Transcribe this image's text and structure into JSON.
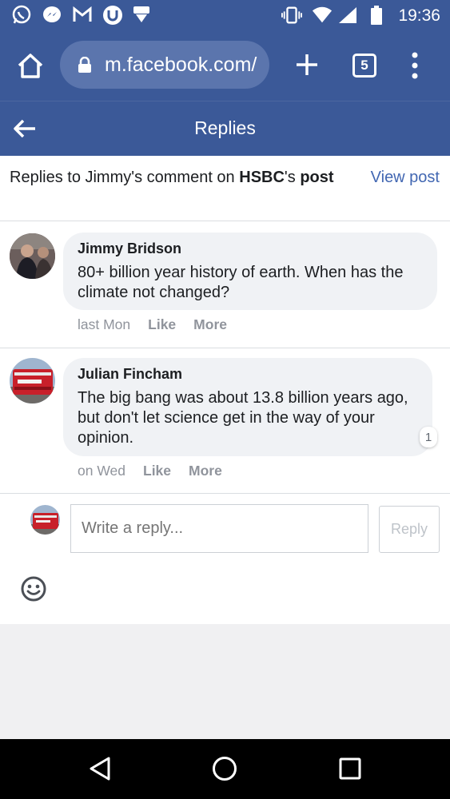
{
  "status_bar": {
    "time": "19:36",
    "left_icons": [
      "whatsapp-icon",
      "messenger-icon",
      "gmail-icon",
      "u-app-icon",
      "download-icon"
    ],
    "right_icons": [
      "vibrate-icon",
      "wifi-icon",
      "signal-icon",
      "battery-icon"
    ]
  },
  "browser": {
    "url": "m.facebook.com/",
    "tab_count": "5"
  },
  "header": {
    "title": "Replies"
  },
  "context": {
    "prefix": "Replies to Jimmy's comment on ",
    "page_name": "HSBC",
    "possessive": "'s",
    "suffix": "post",
    "view_post": "View post"
  },
  "comments": [
    {
      "author": "Jimmy Bridson",
      "text": "80+ billion year history of earth. When has the climate not changed?",
      "time": "last Mon",
      "like": "Like",
      "more": "More"
    },
    {
      "author": "Julian Fincham",
      "text": "The big bang was about 13.8 billion years ago, but don't let science get in the way of your opinion.",
      "time": "on Wed",
      "like": "Like",
      "more": "More",
      "reactions": "1"
    }
  ],
  "reply": {
    "placeholder": "Write a reply...",
    "button": "Reply"
  },
  "colors": {
    "brand": "#3b5998",
    "link": "#4267b2",
    "bubble": "#f0f2f5"
  }
}
